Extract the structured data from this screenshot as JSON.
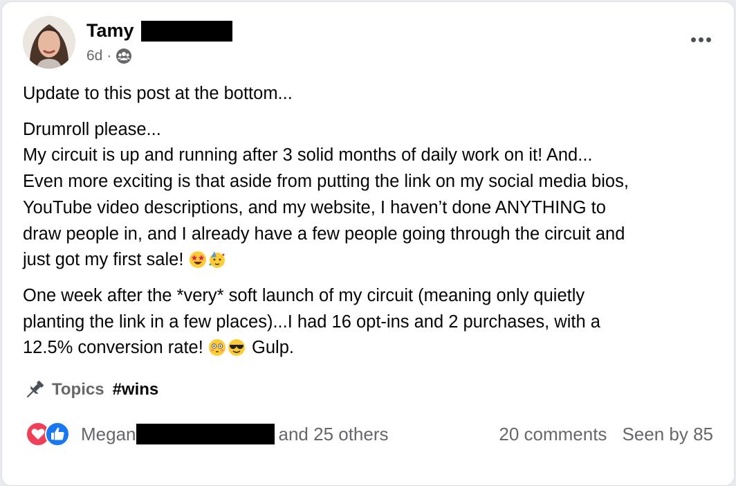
{
  "post": {
    "author": "Tamy",
    "timestamp": "6d",
    "separator": "·",
    "audience_icon": "group-icon",
    "more_icon": "more-options-icon",
    "paragraphs": [
      {
        "lines": [
          "Update to this post at the bottom..."
        ]
      },
      {
        "lines": [
          "Drumroll please...",
          "My circuit is up and running after 3 solid months of daily work on it!  And...",
          "Even more exciting is that aside from putting the link on my social media bios,",
          "YouTube video descriptions, and my website, I haven’t done ANYTHING to",
          "draw people in, and I already have a few people going through the circuit and",
          "just got my first sale!"
        ]
      },
      {
        "lines": [
          "One week after the *very* soft launch of my circuit (meaning only quietly",
          "planting the link in a few places)...I had 16 opt-ins and 2 purchases, with a",
          "12.5% conversion rate!",
          "Gulp."
        ]
      }
    ],
    "emojis": {
      "sale": [
        "star-struck-emoji",
        "partying-face-emoji"
      ],
      "conversion": [
        "flushed-face-emoji",
        "smiling-face-with-sunglasses-emoji"
      ]
    },
    "topics": {
      "icon": "pushpin-icon",
      "label": "Topics",
      "tag": "#wins"
    }
  },
  "footer": {
    "reaction_icons": [
      "love-reaction-icon",
      "like-reaction-icon"
    ],
    "reactor_name": "Megan",
    "others_text": "and 25 others",
    "comments": "20 comments",
    "seen_by": "Seen by 85"
  },
  "colors": {
    "text": "#050505",
    "secondary": "#65676b",
    "love": "#f33e58",
    "like": "#1877f2"
  }
}
